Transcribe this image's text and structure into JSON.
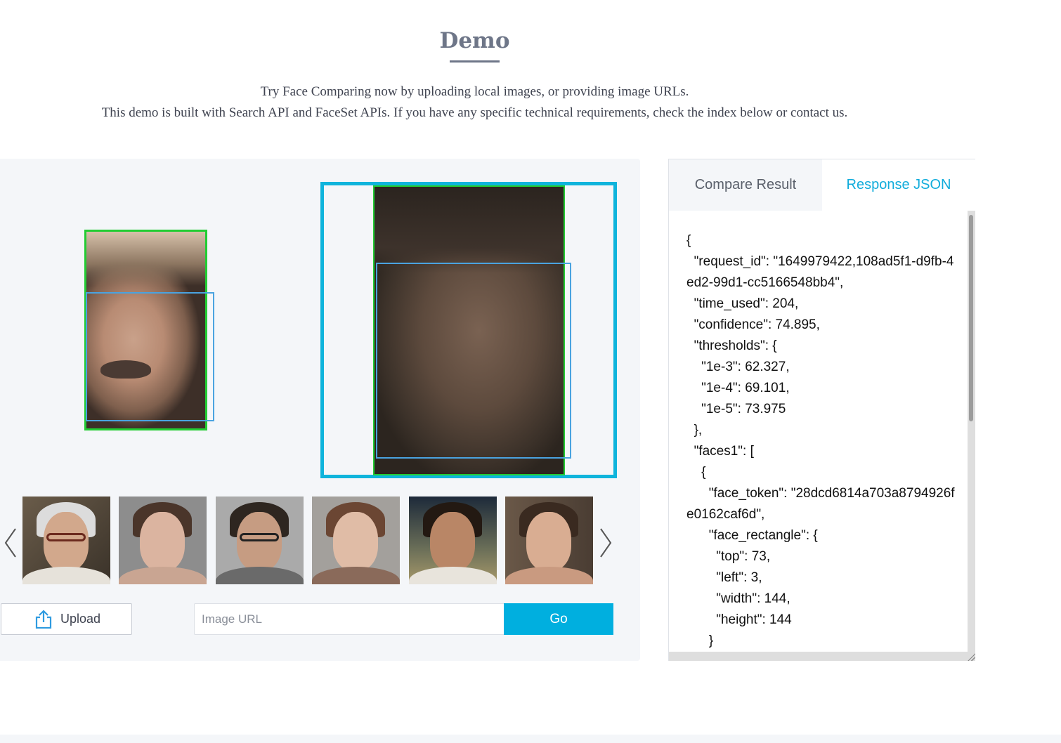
{
  "header": {
    "title": "Demo",
    "description_line1": "Try Face Comparing now by uploading local images, or providing image URLs.",
    "description_line2": "This demo is built with Search API and FaceSet APIs. If you have any specific technical requirements, check the index below or contact us."
  },
  "gallery": {
    "prev_icon": "chevron-left-icon",
    "next_icon": "chevron-right-icon",
    "thumbnails": [
      "elderly-man-glasses",
      "woman-portrait",
      "man-glasses-beard",
      "girl-smiling",
      "woman-laughing",
      "woman-hand-on-face"
    ]
  },
  "controls": {
    "upload_label": "Upload",
    "upload_icon": "share-upload-icon",
    "url_placeholder": "Image URL",
    "go_label": "Go"
  },
  "result_panel": {
    "tabs": [
      {
        "label": "Compare Result",
        "active": false
      },
      {
        "label": "Response JSON",
        "active": true
      }
    ],
    "json_text": "{\n  \"request_id\": \"1649979422,108ad5f1-d9fb-4ed2-99d1-cc5166548bb4\",\n  \"time_used\": 204,\n  \"confidence\": 74.895,\n  \"thresholds\": {\n    \"1e-3\": 62.327,\n    \"1e-4\": 69.101,\n    \"1e-5\": 73.975\n  },\n  \"faces1\": [\n    {\n      \"face_token\": \"28dcd6814a703a8794926fe0162caf6d\",\n      \"face_rectangle\": {\n        \"top\": 73,\n        \"left\": 3,\n        \"width\": 144,\n        \"height\": 144\n      }"
  },
  "colors": {
    "accent": "#00afdf",
    "face_box": "#22cc33",
    "detect_box": "#4aa3e0",
    "selected_frame": "#0fb4dc",
    "title": "#6e7688"
  }
}
